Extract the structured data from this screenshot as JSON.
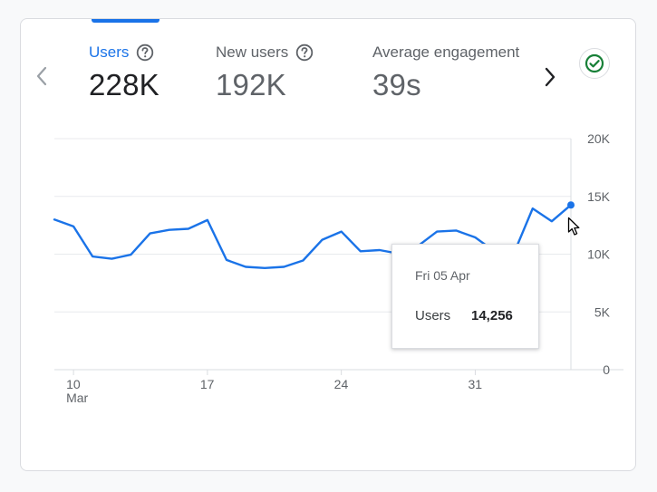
{
  "tabs": [
    {
      "label": "Users",
      "value": "228K",
      "active": true
    },
    {
      "label": "New users",
      "value": "192K",
      "active": false
    },
    {
      "label": "Average engagement",
      "value": "39s",
      "active": false
    }
  ],
  "colors": {
    "accent": "#1a73e8",
    "status_ok": "#188038"
  },
  "icons": {
    "prev": "chevron-left-icon",
    "next": "chevron-right-icon",
    "help": "help-circle-icon",
    "status": "check-circle-icon"
  },
  "chart_data": {
    "type": "line",
    "x": [
      "2024-03-09",
      "2024-03-10",
      "2024-03-11",
      "2024-03-12",
      "2024-03-13",
      "2024-03-14",
      "2024-03-15",
      "2024-03-16",
      "2024-03-17",
      "2024-03-18",
      "2024-03-19",
      "2024-03-20",
      "2024-03-21",
      "2024-03-22",
      "2024-03-23",
      "2024-03-24",
      "2024-03-25",
      "2024-03-26",
      "2024-03-27",
      "2024-03-28",
      "2024-03-29",
      "2024-03-30",
      "2024-03-31",
      "2024-04-01",
      "2024-04-02",
      "2024-04-03",
      "2024-04-04",
      "2024-04-05"
    ],
    "series": [
      {
        "values": [
          13000,
          12400,
          9800,
          9600,
          9950,
          11800,
          12100,
          12200,
          12950,
          9500,
          8900,
          8800,
          8900,
          9450,
          11250,
          11950,
          10250,
          10350,
          10050,
          10700,
          11950,
          12050,
          11450,
          10250,
          10000,
          13950,
          12850,
          14256
        ]
      }
    ],
    "ylim": [
      0,
      20000
    ],
    "y_ticks": [
      "0",
      "5K",
      "10K",
      "15K",
      "20K"
    ],
    "x_ticks": [
      {
        "date": "2024-03-10",
        "label": "10",
        "sublabel": "Mar"
      },
      {
        "date": "2024-03-17",
        "label": "17",
        "sublabel": ""
      },
      {
        "date": "2024-03-24",
        "label": "24",
        "sublabel": ""
      },
      {
        "date": "2024-03-31",
        "label": "31",
        "sublabel": ""
      }
    ],
    "grid": true,
    "tooltip": {
      "date": "Fri 05 Apr",
      "metric": "Users",
      "value": "14,256"
    }
  }
}
